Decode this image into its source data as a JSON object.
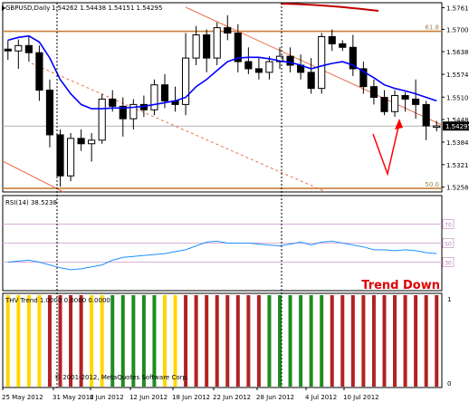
{
  "main_panel": {
    "symbol_label": "GBPUSD,Daily",
    "ohlc_label": "1.54262 1.54438 1.54151 1.54295",
    "fib_labels": [
      "61.8",
      "50.0"
    ],
    "current_price": "1.54295",
    "price_axis": [
      "1.57610",
      "1.57005",
      "1.56380",
      "1.55745",
      "1.55105",
      "1.54480",
      "1.53845",
      "1.53215",
      "1.52585"
    ],
    "colors": {
      "bull_candle": "#ffffff",
      "bear_candle": "#000000",
      "ma": "#0000ff",
      "fib_line": "#c87f3c",
      "channel": "#e8704a",
      "top_line": "#c00000",
      "arrow": "#ff0000"
    }
  },
  "chart_data": {
    "type": "candlestick",
    "ylim": [
      1.5245,
      1.5775
    ],
    "candles": [
      {
        "o": 1.5645,
        "h": 1.567,
        "l": 1.5615,
        "c": 1.564
      },
      {
        "o": 1.564,
        "h": 1.5672,
        "l": 1.559,
        "c": 1.5655
      },
      {
        "o": 1.5655,
        "h": 1.568,
        "l": 1.561,
        "c": 1.5635
      },
      {
        "o": 1.5635,
        "h": 1.5655,
        "l": 1.55,
        "c": 1.553
      },
      {
        "o": 1.553,
        "h": 1.556,
        "l": 1.537,
        "c": 1.5405
      },
      {
        "o": 1.5405,
        "h": 1.542,
        "l": 1.526,
        "c": 1.529
      },
      {
        "o": 1.529,
        "h": 1.541,
        "l": 1.5275,
        "c": 1.5395
      },
      {
        "o": 1.5395,
        "h": 1.542,
        "l": 1.536,
        "c": 1.538
      },
      {
        "o": 1.538,
        "h": 1.541,
        "l": 1.533,
        "c": 1.539
      },
      {
        "o": 1.539,
        "h": 1.552,
        "l": 1.538,
        "c": 1.5505
      },
      {
        "o": 1.5505,
        "h": 1.553,
        "l": 1.547,
        "c": 1.5485
      },
      {
        "o": 1.5485,
        "h": 1.551,
        "l": 1.54,
        "c": 1.545
      },
      {
        "o": 1.545,
        "h": 1.5505,
        "l": 1.542,
        "c": 1.549
      },
      {
        "o": 1.549,
        "h": 1.5515,
        "l": 1.5455,
        "c": 1.5475
      },
      {
        "o": 1.5475,
        "h": 1.556,
        "l": 1.546,
        "c": 1.5545
      },
      {
        "o": 1.5545,
        "h": 1.5575,
        "l": 1.548,
        "c": 1.55
      },
      {
        "o": 1.55,
        "h": 1.554,
        "l": 1.547,
        "c": 1.549
      },
      {
        "o": 1.549,
        "h": 1.569,
        "l": 1.546,
        "c": 1.562
      },
      {
        "o": 1.562,
        "h": 1.571,
        "l": 1.56,
        "c": 1.5685
      },
      {
        "o": 1.5685,
        "h": 1.57,
        "l": 1.558,
        "c": 1.562
      },
      {
        "o": 1.562,
        "h": 1.572,
        "l": 1.56,
        "c": 1.5705
      },
      {
        "o": 1.5705,
        "h": 1.574,
        "l": 1.567,
        "c": 1.569
      },
      {
        "o": 1.569,
        "h": 1.5715,
        "l": 1.558,
        "c": 1.561
      },
      {
        "o": 1.561,
        "h": 1.565,
        "l": 1.5575,
        "c": 1.559
      },
      {
        "o": 1.559,
        "h": 1.562,
        "l": 1.556,
        "c": 1.558
      },
      {
        "o": 1.558,
        "h": 1.5625,
        "l": 1.556,
        "c": 1.561
      },
      {
        "o": 1.561,
        "h": 1.565,
        "l": 1.559,
        "c": 1.5625
      },
      {
        "o": 1.5625,
        "h": 1.565,
        "l": 1.558,
        "c": 1.56
      },
      {
        "o": 1.56,
        "h": 1.563,
        "l": 1.556,
        "c": 1.558
      },
      {
        "o": 1.558,
        "h": 1.562,
        "l": 1.552,
        "c": 1.5535
      },
      {
        "o": 1.5535,
        "h": 1.569,
        "l": 1.552,
        "c": 1.568
      },
      {
        "o": 1.568,
        "h": 1.57,
        "l": 1.564,
        "c": 1.566
      },
      {
        "o": 1.566,
        "h": 1.567,
        "l": 1.564,
        "c": 1.565
      },
      {
        "o": 1.565,
        "h": 1.5685,
        "l": 1.557,
        "c": 1.559
      },
      {
        "o": 1.559,
        "h": 1.561,
        "l": 1.552,
        "c": 1.554
      },
      {
        "o": 1.554,
        "h": 1.556,
        "l": 1.549,
        "c": 1.551
      },
      {
        "o": 1.551,
        "h": 1.553,
        "l": 1.546,
        "c": 1.547
      },
      {
        "o": 1.547,
        "h": 1.553,
        "l": 1.5455,
        "c": 1.5515
      },
      {
        "o": 1.5515,
        "h": 1.5525,
        "l": 1.547,
        "c": 1.5505
      },
      {
        "o": 1.5505,
        "h": 1.556,
        "l": 1.545,
        "c": 1.549
      },
      {
        "o": 1.549,
        "h": 1.55,
        "l": 1.539,
        "c": 1.543
      },
      {
        "o": 1.5426,
        "h": 1.5444,
        "l": 1.5415,
        "c": 1.543
      }
    ],
    "ma": [
      1.567,
      1.5678,
      1.5682,
      1.5665,
      1.562,
      1.556,
      1.552,
      1.549,
      1.5478,
      1.5478,
      1.548,
      1.548,
      1.5482,
      1.5485,
      1.549,
      1.5495,
      1.55,
      1.551,
      1.554,
      1.556,
      1.5585,
      1.561,
      1.562,
      1.5622,
      1.5622,
      1.5618,
      1.5612,
      1.5608,
      1.56,
      1.559,
      1.5598,
      1.5605,
      1.561,
      1.56,
      1.5582,
      1.5565,
      1.5545,
      1.5535,
      1.5528,
      1.552,
      1.551,
      1.55
    ],
    "fib": [
      {
        "label": "61.8",
        "value": 1.5695
      },
      {
        "label": "50.0",
        "value": 1.5255
      }
    ],
    "rsi": {
      "label": "RSI(14) 38.5238",
      "ylim": [
        0,
        100
      ],
      "levels": [
        {
          "value": 70,
          "label": "70"
        },
        {
          "value": 50,
          "label": "50"
        },
        {
          "value": 30,
          "label": "30"
        }
      ],
      "values": [
        30,
        31,
        32,
        30,
        27,
        24,
        22,
        23,
        25,
        27,
        32,
        35,
        36,
        37,
        38,
        39,
        41,
        43,
        47,
        51,
        52,
        50,
        50,
        50,
        49,
        48,
        47,
        49,
        51,
        48,
        51,
        52,
        50,
        48,
        46,
        43,
        43,
        42,
        43,
        42,
        40,
        39
      ]
    },
    "trend_text": "Trend Down",
    "thv": {
      "label": "THV Trend 1.0000 0.0000 0.0000",
      "axis": [
        "1",
        "0"
      ],
      "bars": [
        "yellow",
        "yellow",
        "yellow",
        "yellow",
        "red",
        "red",
        "red",
        "red",
        "yellow",
        "yellow",
        "green",
        "green",
        "green",
        "green",
        "green",
        "yellow",
        "yellow",
        "red",
        "red",
        "red",
        "red",
        "red",
        "red",
        "red",
        "red",
        "green",
        "green",
        "green",
        "green",
        "green",
        "green",
        "red",
        "red",
        "red",
        "red",
        "red",
        "red",
        "red",
        "red",
        "red",
        "red",
        "red"
      ],
      "copyright": "© 2001-2012, MetaQuotes Software Corp."
    },
    "x_labels": [
      "25 May 2012",
      "31 May 2012",
      "6 Jun 2012",
      "12 Jun 2012",
      "18 Jun 2012",
      "22 Jun 2012",
      "28 Jun 2012",
      "4 Jul 2012",
      "10 Jul 2012"
    ]
  }
}
